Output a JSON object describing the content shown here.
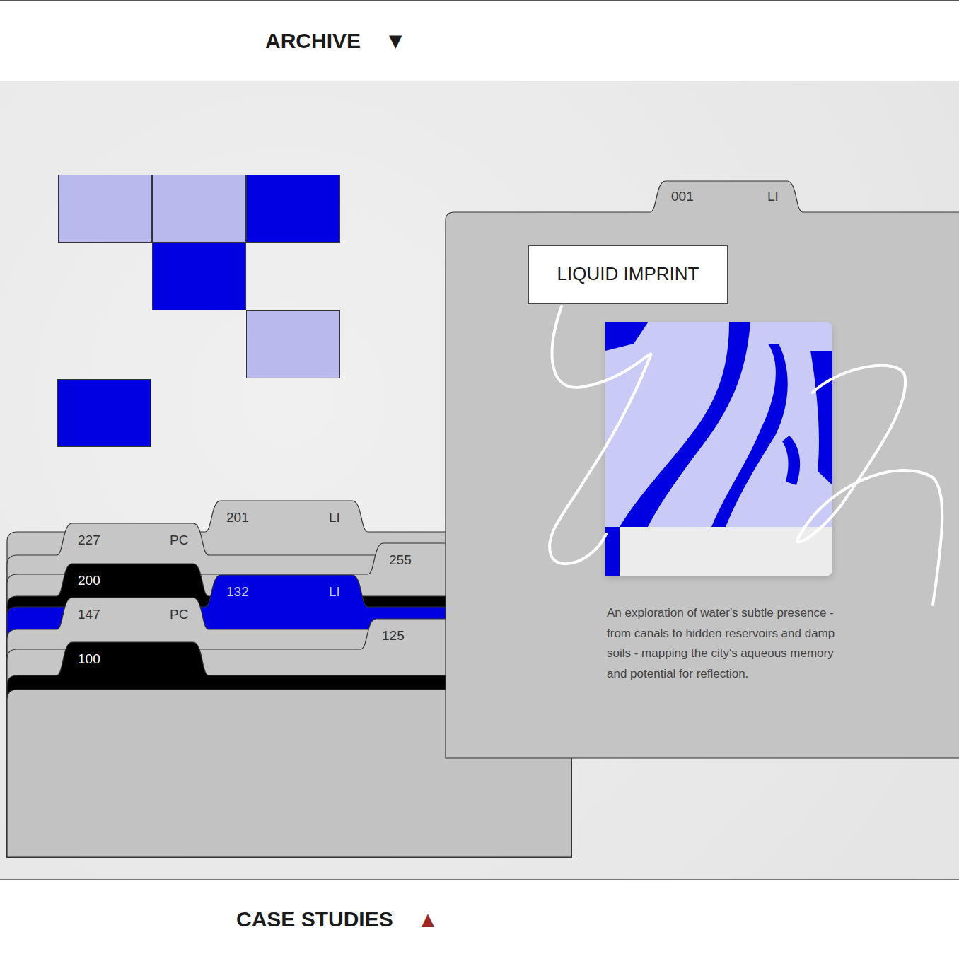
{
  "header": {
    "title": "ARCHIVE",
    "toggle": "▼"
  },
  "tiles": [
    {
      "color": "#b8baee"
    },
    {
      "color": "#b8baee"
    },
    {
      "color": "#0000e0"
    },
    {
      "color": "#0000e0"
    },
    {
      "color": "#b8baee"
    },
    {
      "color": "#0000e0"
    }
  ],
  "folders": [
    {
      "number": "201",
      "code": "LI",
      "kind": "grey"
    },
    {
      "number": "227",
      "code": "PC",
      "kind": "grey"
    },
    {
      "number": "255",
      "kind": "grey"
    },
    {
      "number": "200",
      "kind": "black"
    },
    {
      "number": "132",
      "code": "LI",
      "kind": "blue"
    },
    {
      "number": "147",
      "code": "PC",
      "kind": "grey"
    },
    {
      "number": "125",
      "kind": "grey"
    },
    {
      "number": "100",
      "kind": "black"
    }
  ],
  "featured": {
    "number": "001",
    "code": "LI",
    "title": "LIQUID IMPRINT",
    "description": "An exploration of water's subtle presence - from canals to hidden reservoirs and damp soils - mapping the city's aqueous memory and potential for reflection."
  },
  "footer": {
    "title": "CASE STUDIES",
    "toggle": "▲"
  }
}
